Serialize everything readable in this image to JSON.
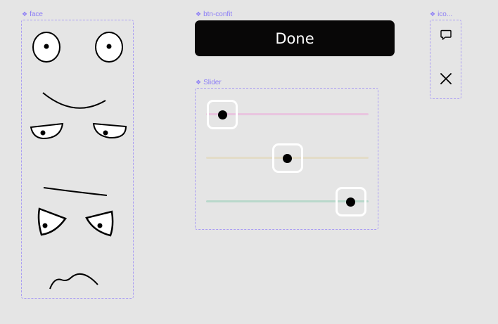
{
  "components": {
    "face": {
      "label": "face"
    },
    "button": {
      "label": "btn-confit",
      "text": "Done"
    },
    "slider": {
      "label": "Slider"
    },
    "icons": {
      "label": "ico..."
    }
  },
  "sliders": [
    {
      "value": 0.1,
      "track_color": "#e9c5df"
    },
    {
      "value": 0.5,
      "track_color": "#e3dcc8"
    },
    {
      "value": 0.89,
      "track_color": "#b9d8cb"
    }
  ],
  "icons": [
    "comment-icon",
    "close-icon"
  ],
  "colors": {
    "canvas": "#e5e5e5",
    "component_accent": "#8b7cf6",
    "button_bg": "#080707",
    "button_text": "#ffffff"
  }
}
